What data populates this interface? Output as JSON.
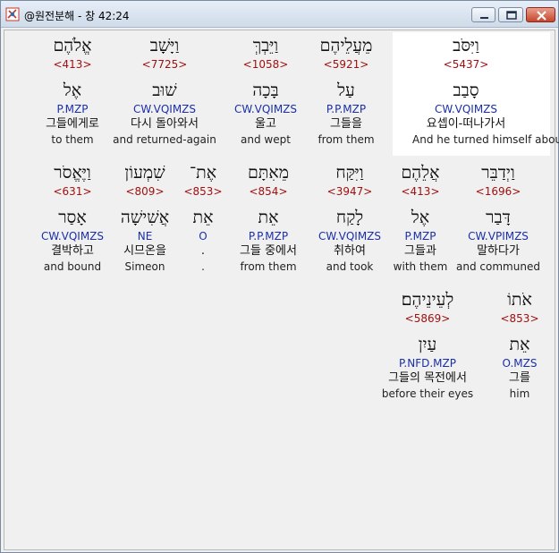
{
  "window": {
    "title": "@원전분해 - 창 42:24"
  },
  "rows": [
    [
      {
        "heb": "אֱלֹהֶם",
        "strong": "<413>",
        "lemma": "אֶל",
        "parse": "P.MZP",
        "korean": "그들에게로",
        "english": "to them"
      },
      {
        "heb": "וַיָּשָׁב",
        "strong": "<7725>",
        "lemma": "שׁוּב",
        "parse": "CW.VQIMZS",
        "korean": "다시 돌아와서",
        "english": "and returned-again"
      },
      {
        "heb": "וַיֵּבְךְּ",
        "strong": "<1058>",
        "lemma": "בָּכָה",
        "parse": "CW.VQIMZS",
        "korean": "울고",
        "english": "and wept"
      },
      {
        "heb": "מֵעֲלֵיהֶם",
        "strong": "<5921>",
        "lemma": "עַל",
        "parse": "P.P.MZP",
        "korean": "그들을",
        "english": "from them"
      },
      {
        "heb": "וַיִּסֹּב",
        "strong": "<5437>",
        "lemma": "סָבַב",
        "parse": "CW.VQIMZS",
        "korean": "요셉이-떠나가서",
        "english": "And he turned himself about"
      }
    ],
    [
      {
        "heb": "וַיֶּאֱסֹר",
        "strong": "<631>",
        "lemma": "אָסַר",
        "parse": "CW.VQIMZS",
        "korean": "결박하고",
        "english": "and bound"
      },
      {
        "heb": "שִׁמְעוֹן",
        "strong": "<809>",
        "lemma": "אֲשִׁישָׁה",
        "parse": "NE",
        "korean": "시므온을",
        "english": "Simeon"
      },
      {
        "heb": "אֶת־",
        "strong": "<853>",
        "lemma": "אֵת",
        "parse": "O",
        "korean": ".",
        "english": "."
      },
      {
        "heb": "מֵאִתָּם",
        "strong": "<854>",
        "lemma": "אֵת",
        "parse": "P.P.MZP",
        "korean": "그들 중에서",
        "english": "from them"
      },
      {
        "heb": "וַיִּקַּח",
        "strong": "<3947>",
        "lemma": "לָקַח",
        "parse": "CW.VQIMZS",
        "korean": "취하여",
        "english": "and took"
      },
      {
        "heb": "אֲלֵהֶם",
        "strong": "<413>",
        "lemma": "אֶל",
        "parse": "P.MZP",
        "korean": "그들과",
        "english": "with them"
      },
      {
        "heb": "וַיְדַבֵּר",
        "strong": "<1696>",
        "lemma": "דָּבַר",
        "parse": "CW.VPIMZS",
        "korean": "말하다가",
        "english": "and communed"
      }
    ],
    [
      {
        "heb": "לְעֵינֵיהֶם׃",
        "strong": "<5869>",
        "lemma": "עַיִן",
        "parse": "P.NFD.MZP",
        "korean": "그들의 목전에서",
        "english": "before their eyes"
      },
      {
        "heb": "אֹתוֹ",
        "strong": "<853>",
        "lemma": "אֵת",
        "parse": "O.MZS",
        "korean": "그를",
        "english": "him"
      }
    ]
  ]
}
